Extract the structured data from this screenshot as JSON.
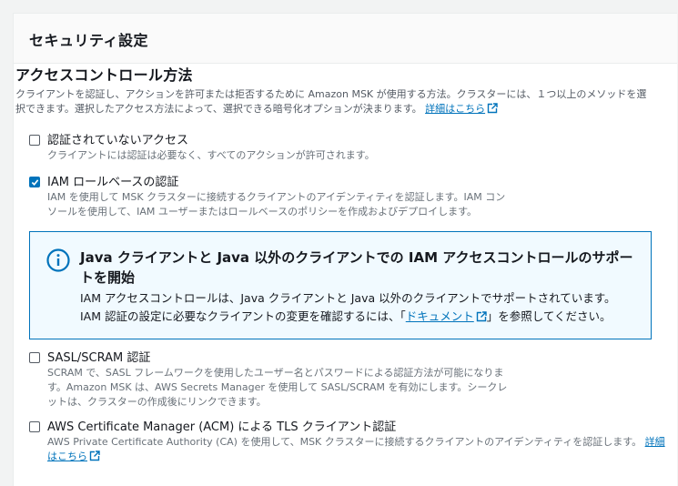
{
  "panel": {
    "title": "セキュリティ設定"
  },
  "access": {
    "title": "アクセスコントロール方法",
    "desc": "クライアントを認証し、アクションを許可または拒否するために Amazon MSK が使用する方法。クラスターには、１つ以上のメソッドを選択できます。選択したアクセス方法によって、選択できる暗号化オプションが決まります。",
    "link": "詳細はこちら"
  },
  "options": {
    "unauth": {
      "label": "認証されていないアクセス",
      "desc": "クライアントには認証は必要なく、すべてのアクションが許可されます。",
      "checked": false
    },
    "iam": {
      "label": "IAM ロールベースの認証",
      "desc": "IAM を使用して MSK クラスターに接続するクライアントのアイデンティティを認証します。IAM コンソールを使用して、IAM ユーザーまたはロールベースのポリシーを作成およびデプロイします。",
      "checked": true
    },
    "sasl": {
      "label": "SASL/SCRAM 認証",
      "desc": "SCRAM で、SASL フレームワークを使用したユーザー名とパスワードによる認証方法が可能になります。Amazon MSK は、AWS Secrets Manager を使用して SASL/SCRAM を有効にします。シークレットは、クラスターの作成後にリンクできます。",
      "checked": false
    },
    "acm": {
      "label": "AWS Certificate Manager (ACM) による TLS クライアント認証",
      "desc": "AWS Private Certificate Authority (CA) を使用して、MSK クラスターに接続するクライアントのアイデンティティを認証します。",
      "link": "詳細はこちら",
      "checked": false
    }
  },
  "info": {
    "title": "Java クライアントと Java 以外のクライアントでの IAM アクセスコントロールのサポートを開始",
    "line1": "IAM アクセスコントロールは、Java クライアントと Java 以外のクライアントでサポートされています。",
    "line2_pre": "IAM 認証の設定に必要なクライアントの変更を確認するには、「",
    "line2_link": "ドキュメント",
    "line2_post": "」を参照してください。"
  }
}
